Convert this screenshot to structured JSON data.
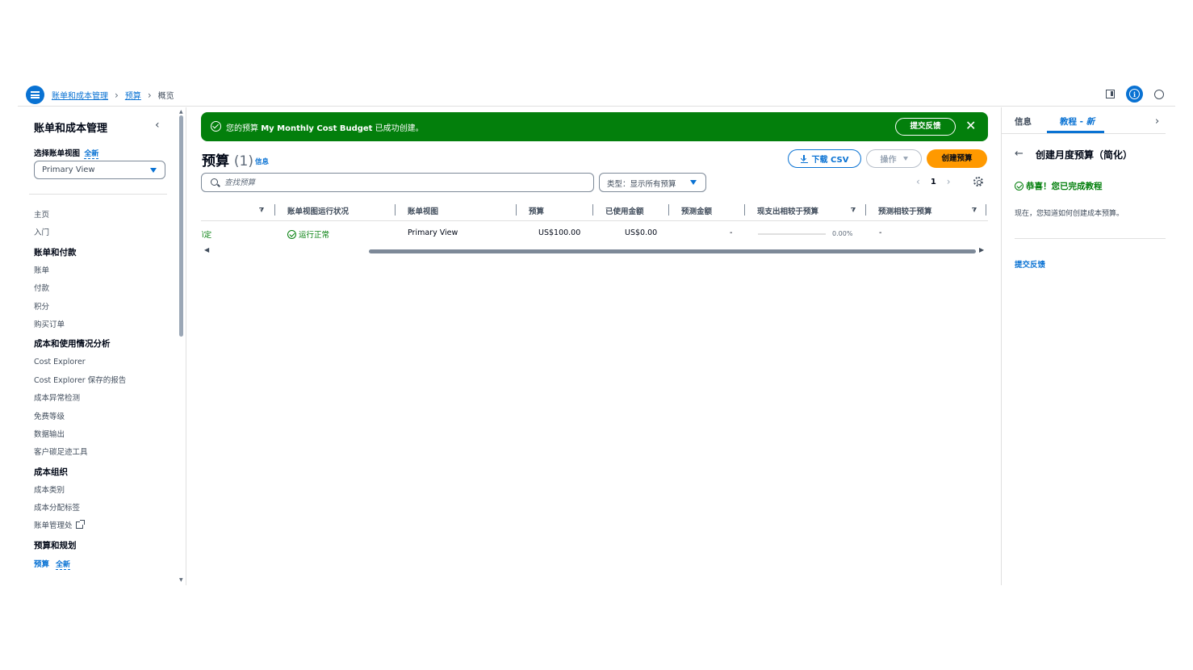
{
  "topbar": {
    "breadcrumbs": [
      "账单和成本管理",
      "预算",
      "概览"
    ]
  },
  "sidebar": {
    "title": "账单和成本管理",
    "view_label": "选择账单视图",
    "view_new_badge": "全新",
    "view_value": "Primary View",
    "nav": [
      {
        "type": "item",
        "label": "主页"
      },
      {
        "type": "item",
        "label": "入门"
      },
      {
        "type": "section",
        "label": "账单和付款"
      },
      {
        "type": "item",
        "label": "账单"
      },
      {
        "type": "item",
        "label": "付款"
      },
      {
        "type": "item",
        "label": "积分"
      },
      {
        "type": "item",
        "label": "购买订单"
      },
      {
        "type": "section",
        "label": "成本和使用情况分析"
      },
      {
        "type": "item",
        "label": "Cost Explorer"
      },
      {
        "type": "item",
        "label": "Cost Explorer 保存的报告"
      },
      {
        "type": "item",
        "label": "成本异常检测"
      },
      {
        "type": "item",
        "label": "免费等级"
      },
      {
        "type": "item",
        "label": "数据输出"
      },
      {
        "type": "item",
        "label": "客户碳足迹工具"
      },
      {
        "type": "section",
        "label": "成本组织"
      },
      {
        "type": "item",
        "label": "成本类别"
      },
      {
        "type": "item",
        "label": "成本分配标签"
      },
      {
        "type": "item",
        "label": "账单管理处",
        "external": true
      },
      {
        "type": "section",
        "label": "预算和规划"
      },
      {
        "type": "active",
        "label": "预算",
        "badge": "全新"
      }
    ]
  },
  "flash": {
    "prefix": "您的预算 ",
    "budget_name": "My Monthly Cost Budget",
    "suffix": " 已成功创建。",
    "feedback_button": "提交反馈"
  },
  "main": {
    "title": "预算",
    "count": "(1)",
    "info_link": "信息",
    "download_csv": "下载 CSV",
    "actions": "操作",
    "create_budget": "创建预算",
    "search_placeholder": "查找预算",
    "type_filter": "类型：显示所有预算",
    "page_number": "1",
    "columns": [
      "账单视图运行状况",
      "账单视图",
      "预算",
      "已使用金额",
      "预测金额",
      "现支出相较于预算",
      "预测相较于预算"
    ],
    "row": {
      "name_fragment": "ì定",
      "health": "运行正常",
      "billing_view": "Primary View",
      "budget": "US$100.00",
      "used": "US$0.00",
      "forecast": "-",
      "actual_vs_budget": "0.00%",
      "forecast_vs_budget": "-"
    }
  },
  "help_panel": {
    "tab_info": "信息",
    "tab_tutorial": "教程 - ",
    "tab_tutorial_new": "新",
    "title": "创建月度预算（简化）",
    "success": "恭喜！您已完成教程",
    "description": "现在，您知道如何创建成本预算。",
    "feedback": "提交反馈"
  }
}
